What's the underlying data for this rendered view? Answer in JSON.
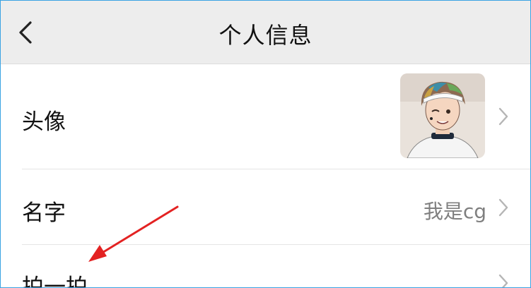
{
  "header": {
    "title": "个人信息",
    "back_icon": "chevron-left-icon"
  },
  "rows": [
    {
      "label": "头像",
      "value": "",
      "icon": "chevron-right-icon"
    },
    {
      "label": "名字",
      "value": "我是cg",
      "icon": "chevron-right-icon"
    },
    {
      "label": "拍一拍",
      "value": "",
      "icon": "chevron-right-icon"
    }
  ],
  "colors": {
    "header_bg": "#ededed",
    "annotation_arrow": "#e32222",
    "frame_border": "#3aa3e3"
  }
}
